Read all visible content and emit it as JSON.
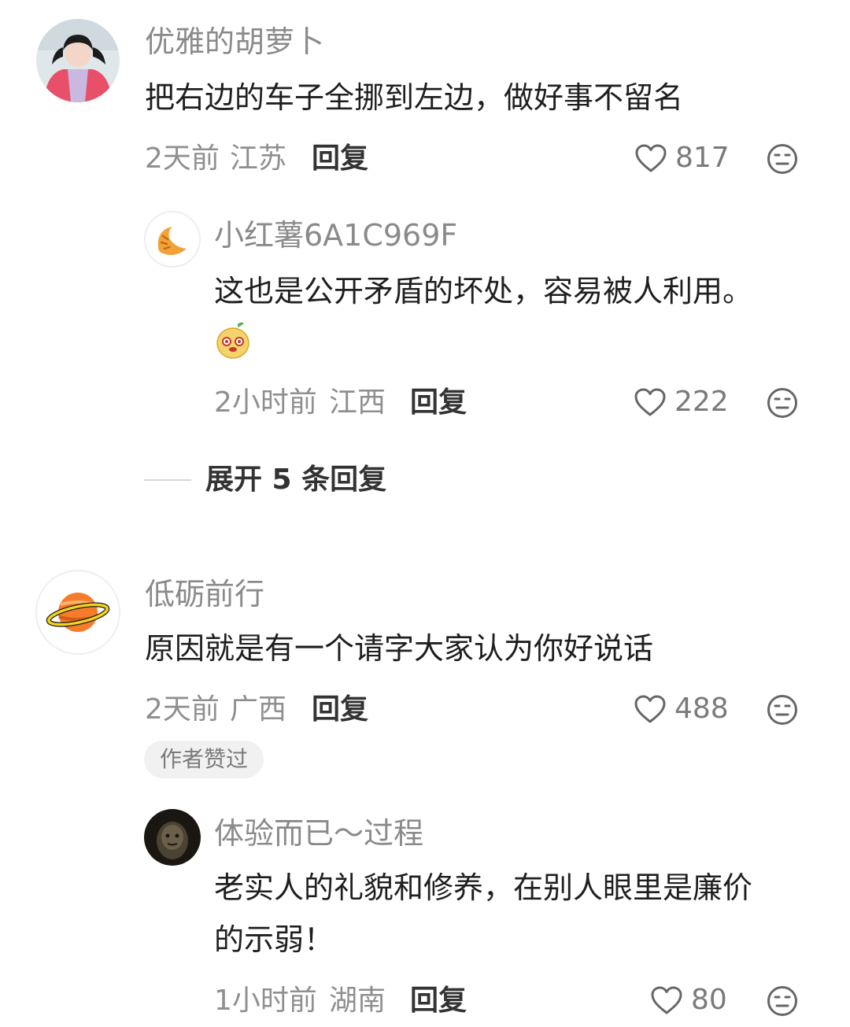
{
  "comments": [
    {
      "username": "优雅的胡萝卜",
      "content": "把右边的车子全挪到左边，做好事不留名",
      "time": "2天前",
      "location": "江苏",
      "reply_label": "回复",
      "likes": "817",
      "replies": [
        {
          "username": "小红薯6A1C969F",
          "content": "这也是公开矛盾的坏处，容易被人利用。",
          "time": "2小时前",
          "location": "江西",
          "reply_label": "回复",
          "likes": "222"
        }
      ],
      "expand_label": "展开 5 条回复"
    },
    {
      "username": "低砺前行",
      "content": "原因就是有一个请字大家认为你好说话",
      "time": "2天前",
      "location": "广西",
      "reply_label": "回复",
      "likes": "488",
      "badge": "作者赞过",
      "replies": [
        {
          "username": "体验而已～过程",
          "content_line1": "老实人的礼貌和修养，在别人眼里是廉价",
          "content_line2": "的示弱！",
          "time": "1小时前",
          "location": "湖南",
          "reply_label": "回复",
          "likes": "80"
        }
      ]
    }
  ],
  "icons": {
    "like": "heart-outline-icon",
    "dislike": "meh-face-icon"
  },
  "colors": {
    "username": "#8a8a8a",
    "meta": "#8f8f8f",
    "text": "#1f1f1f",
    "badge_bg": "#f1f1f1"
  }
}
